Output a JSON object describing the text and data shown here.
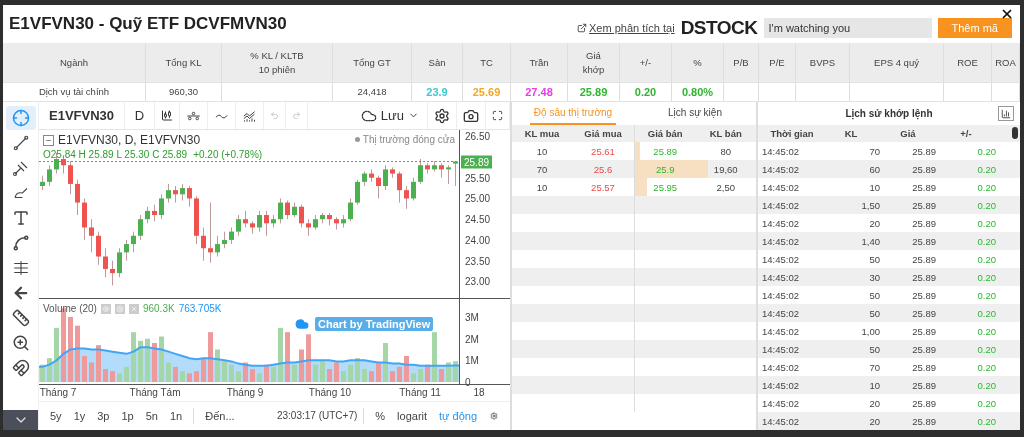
{
  "window": {
    "title": "E1VFVN30 - Quỹ ETF DCVFMVN30"
  },
  "header": {
    "link": "Xem phân tích tại",
    "logo": "DSTOCK",
    "search": {
      "value": "I'm watching you"
    },
    "add_button": "Thêm mã"
  },
  "stats": {
    "columns": [
      {
        "label": "Ngành",
        "value": "Dịch vụ tài chính"
      },
      {
        "label": "Tổng KL",
        "value": "960,30"
      },
      {
        "label": "% KL / KLTB\n10 phiên"
      },
      {
        "label": "Tổng GT",
        "value": "24,418"
      },
      {
        "label": "Sàn",
        "value": "23.9",
        "color": "#3cc8d0"
      },
      {
        "label": "TC",
        "value": "25.69",
        "color": "#f5a623"
      },
      {
        "label": "Trần",
        "value": "27.48",
        "color": "#e83ee8"
      },
      {
        "label": "Giá\nkhớp",
        "value": "25.89",
        "color": "#2fb52f"
      },
      {
        "label": "+/-",
        "value": "0.20",
        "color": "#2fb52f"
      },
      {
        "label": "%",
        "value": "0.80%",
        "color": "#2fb52f"
      },
      {
        "label": "P/B"
      },
      {
        "label": "P/E"
      },
      {
        "label": "BVPS"
      },
      {
        "label": "EPS 4 quý"
      },
      {
        "label": "ROE"
      },
      {
        "label": "ROA"
      }
    ]
  },
  "chart": {
    "symbol": "E1VFVN30",
    "interval": "D",
    "save": "Lưu",
    "tools": [
      {
        "selected": true
      },
      {
        "selected": false
      },
      {
        "selected": false
      },
      {
        "selected": false
      },
      {
        "selected": false
      },
      {
        "selected": false
      },
      {
        "selected": false
      },
      {
        "selected": false
      },
      {
        "selected": false
      },
      {
        "selected": false
      },
      {
        "selected": false
      }
    ],
    "legend": "E1VFVN30, D, E1VFVN30",
    "status": "Thị trường đóng cửa",
    "ohlc": "O25.84 H 25.89 L 25.30 C 25.89",
    "change": "+0.20 (+0.78%)",
    "price_panel": {
      "chart_data": {
        "type": "candlestick",
        "ylim": [
          22.6,
          26.65
        ],
        "ref_lines": [
          {
            "axis": "y",
            "value": 25.89,
            "label": "25.89",
            "color": "#4caf50"
          }
        ],
        "ohlc": [
          [
            25.3,
            25.55,
            25.2,
            25.4
          ],
          [
            25.4,
            25.8,
            25.3,
            25.7
          ],
          [
            25.7,
            26.1,
            25.6,
            25.95
          ],
          [
            25.95,
            26.05,
            25.6,
            25.8
          ],
          [
            25.8,
            25.9,
            25.1,
            25.35
          ],
          [
            25.35,
            25.45,
            24.6,
            24.9
          ],
          [
            24.9,
            25.0,
            24.0,
            24.3
          ],
          [
            24.3,
            24.5,
            23.7,
            24.1
          ],
          [
            24.1,
            24.2,
            23.4,
            23.6
          ],
          [
            23.6,
            23.8,
            23.1,
            23.3
          ],
          [
            23.3,
            23.5,
            22.9,
            23.2
          ],
          [
            23.2,
            23.8,
            23.1,
            23.7
          ],
          [
            23.7,
            24.0,
            23.5,
            23.9
          ],
          [
            23.9,
            24.2,
            23.7,
            24.1
          ],
          [
            24.1,
            24.6,
            24.0,
            24.5
          ],
          [
            24.5,
            24.8,
            24.4,
            24.7
          ],
          [
            24.7,
            24.85,
            24.45,
            24.6
          ],
          [
            24.6,
            25.1,
            24.5,
            25.0
          ],
          [
            25.0,
            25.35,
            24.9,
            25.2
          ],
          [
            25.2,
            25.3,
            24.9,
            25.1
          ],
          [
            25.1,
            25.35,
            24.95,
            25.25
          ],
          [
            25.25,
            25.3,
            24.8,
            25.0
          ],
          [
            25.0,
            25.05,
            23.9,
            24.1
          ],
          [
            24.1,
            24.3,
            23.5,
            23.8
          ],
          [
            23.8,
            24.9,
            23.45,
            23.7
          ],
          [
            23.7,
            24.1,
            23.6,
            23.9
          ],
          [
            23.9,
            24.2,
            23.8,
            24.0
          ],
          [
            24.0,
            24.3,
            23.9,
            24.2
          ],
          [
            24.2,
            24.6,
            24.1,
            24.5
          ],
          [
            24.5,
            24.7,
            24.3,
            24.4
          ],
          [
            24.4,
            24.45,
            24.15,
            24.3
          ],
          [
            24.3,
            24.7,
            24.2,
            24.6
          ],
          [
            24.6,
            24.7,
            24.1,
            24.4
          ],
          [
            24.4,
            24.6,
            24.3,
            24.5
          ],
          [
            24.5,
            25.0,
            24.4,
            24.9
          ],
          [
            24.9,
            24.95,
            24.5,
            24.6
          ],
          [
            24.6,
            24.9,
            24.55,
            24.8
          ],
          [
            24.8,
            24.85,
            24.3,
            24.4
          ],
          [
            24.4,
            24.5,
            24.1,
            24.3
          ],
          [
            24.3,
            24.6,
            24.25,
            24.5
          ],
          [
            24.5,
            24.65,
            24.4,
            24.6
          ],
          [
            24.6,
            24.65,
            24.35,
            24.5
          ],
          [
            24.5,
            24.55,
            24.25,
            24.4
          ],
          [
            24.4,
            24.6,
            24.3,
            24.5
          ],
          [
            24.5,
            25.0,
            24.45,
            24.9
          ],
          [
            24.9,
            25.45,
            24.85,
            25.4
          ],
          [
            25.4,
            25.65,
            25.3,
            25.6
          ],
          [
            25.6,
            25.7,
            25.4,
            25.5
          ],
          [
            25.5,
            25.55,
            25.0,
            25.3
          ],
          [
            25.3,
            25.8,
            25.2,
            25.7
          ],
          [
            25.7,
            25.75,
            25.5,
            25.6
          ],
          [
            25.6,
            25.65,
            24.9,
            25.2
          ],
          [
            25.2,
            25.3,
            24.75,
            25.0
          ],
          [
            25.0,
            25.5,
            24.95,
            25.4
          ],
          [
            25.4,
            25.95,
            25.35,
            25.8
          ],
          [
            25.8,
            25.85,
            25.6,
            25.7
          ],
          [
            25.7,
            25.9,
            25.65,
            25.8
          ],
          [
            25.8,
            25.85,
            25.5,
            25.7
          ],
          [
            25.7,
            25.8,
            25.35,
            25.75
          ],
          [
            25.84,
            25.89,
            25.3,
            25.89
          ]
        ],
        "yticks": [
          {
            "value": 26.5,
            "label": "26.50"
          },
          {
            "value": 25.5,
            "label": "25.50"
          },
          {
            "value": 25,
            "label": "25.00"
          },
          {
            "value": 24.5,
            "label": "24.50"
          },
          {
            "value": 24,
            "label": "24.00"
          },
          {
            "value": 23.5,
            "label": "23.50"
          },
          {
            "value": 23,
            "label": "23.00"
          }
        ]
      }
    },
    "time_axis": [
      "Tháng 7",
      "Tháng Tám",
      "Tháng 9",
      "Tháng 10",
      "Tháng 11",
      "18"
    ],
    "volume_value": "960.3K",
    "volume_ma": "763.705K",
    "volume_panel": {
      "chart_data": {
        "type": "bar",
        "ylim": [
          0,
          3.6
        ],
        "series": [
          {
            "name": "Volume (20)",
            "colors": [
              "#a5d6a7",
              "#a5d6a7",
              "#a5d6a7",
              "#ef9a9a",
              "#ef9a9a",
              "#ef9a9a",
              "#ef9a9a",
              "#ef9a9a",
              "#ef9a9a",
              "#ef9a9a",
              "#ef9a9a",
              "#a5d6a7",
              "#a5d6a7",
              "#a5d6a7",
              "#a5d6a7",
              "#a5d6a7",
              "#ef9a9a",
              "#a5d6a7",
              "#a5d6a7",
              "#ef9a9a",
              "#a5d6a7",
              "#ef9a9a",
              "#ef9a9a",
              "#ef9a9a",
              "#ef9a9a",
              "#a5d6a7",
              "#a5d6a7",
              "#a5d6a7",
              "#a5d6a7",
              "#ef9a9a",
              "#ef9a9a",
              "#a5d6a7",
              "#ef9a9a",
              "#a5d6a7",
              "#a5d6a7",
              "#ef9a9a",
              "#a5d6a7",
              "#ef9a9a",
              "#ef9a9a",
              "#a5d6a7",
              "#a5d6a7",
              "#ef9a9a",
              "#ef9a9a",
              "#a5d6a7",
              "#a5d6a7",
              "#a5d6a7",
              "#a5d6a7",
              "#ef9a9a",
              "#ef9a9a",
              "#a5d6a7",
              "#ef9a9a",
              "#ef9a9a",
              "#ef9a9a",
              "#a5d6a7",
              "#a5d6a7",
              "#ef9a9a",
              "#a5d6a7",
              "#ef9a9a",
              "#a5d6a7",
              "#a5d6a7"
            ],
            "values": [
              0.8,
              1.1,
              2.5,
              3.4,
              3.0,
              2.6,
              1.2,
              0.9,
              1.7,
              0.6,
              0.5,
              0.4,
              0.7,
              2.3,
              1.9,
              2.0,
              1.8,
              2.1,
              0.9,
              0.7,
              0.5,
              0.4,
              0.5,
              1.1,
              2.3,
              1.5,
              1.0,
              0.8,
              0.5,
              0.9,
              0.6,
              0.4,
              0.8,
              0.7,
              2.5,
              2.3,
              0.8,
              1.5,
              2.2,
              0.8,
              1.0,
              0.6,
              0.9,
              0.5,
              0.8,
              1.1,
              0.6,
              0.5,
              0.9,
              1.8,
              0.5,
              0.7,
              1.2,
              0.4,
              0.6,
              0.8,
              2.3,
              0.6,
              0.9,
              0.96
            ]
          },
          {
            "type": "area",
            "color": "#42a5f5",
            "values": [
              0.7,
              0.8,
              1.0,
              1.3,
              1.5,
              1.55,
              1.55,
              1.5,
              1.5,
              1.45,
              1.4,
              1.35,
              1.3,
              1.4,
              1.6,
              1.6,
              1.55,
              1.5,
              1.4,
              1.3,
              1.2,
              1.1,
              1.05,
              1.1,
              1.1,
              1.05,
              1.0,
              0.95,
              0.85,
              0.8,
              0.75,
              0.75,
              0.75,
              0.8,
              0.85,
              0.9,
              0.9,
              0.95,
              1.0,
              1.0,
              1.0,
              1.0,
              0.95,
              0.95,
              1.0,
              1.0,
              1.0,
              0.95,
              0.9,
              0.9,
              0.85,
              0.85,
              0.8,
              0.8,
              0.75,
              0.75,
              0.75,
              0.75,
              0.75,
              0.76
            ]
          }
        ],
        "yticks": [
          {
            "value": 3,
            "label": "3M"
          },
          {
            "value": 2,
            "label": "2M"
          },
          {
            "value": 1,
            "label": "1M"
          },
          {
            "value": 0,
            "label": "0"
          }
        ]
      }
    },
    "attribution": "Chart by TradingView",
    "ranges": [
      "5y",
      "1y",
      "3p",
      "1p",
      "5n",
      "1n"
    ],
    "goto": "Đến...",
    "clock": "23:03:17 (UTC+7)",
    "scale_options": [
      {
        "label": "%",
        "selected": false
      },
      {
        "label": "logarit",
        "selected": false
      },
      {
        "label": "tự động",
        "selected": true
      }
    ]
  },
  "order_book": {
    "tabs": [
      {
        "label": "Độ sâu thị trường",
        "selected": true
      },
      {
        "label": "Lịch sự kiện",
        "selected": false
      }
    ],
    "columns": [
      "KL mua",
      "Giá mua",
      "Giá bán",
      "KL bán"
    ],
    "rows": [
      {
        "bid_volume": "10",
        "bid_price": "25.61",
        "ask_price": "25.89",
        "ask_volume": "80",
        "level": 0.04
      },
      {
        "bid_volume": "70",
        "bid_price": "25.6",
        "ask_price": "25.9",
        "ask_volume": "19,60",
        "level": 0.6
      },
      {
        "bid_volume": "10",
        "bid_price": "25.57",
        "ask_price": "25.95",
        "ask_volume": "2,50",
        "level": 0.1
      }
    ]
  },
  "trades": {
    "title": "Lịch sử khớp lệnh",
    "columns": [
      "Thời gian",
      "KL",
      "Giá",
      "+/-"
    ],
    "rows": [
      {
        "time": "14:45:02",
        "volume": "70",
        "price": "25.89",
        "change": "0.20"
      },
      {
        "time": "14:45:02",
        "volume": "60",
        "price": "25.89",
        "change": "0.20"
      },
      {
        "time": "14:45:02",
        "volume": "10",
        "price": "25.89",
        "change": "0.20"
      },
      {
        "time": "14:45:02",
        "volume": "1,50",
        "price": "25.89",
        "change": "0.20"
      },
      {
        "time": "14:45:02",
        "volume": "20",
        "price": "25.89",
        "change": "0.20"
      },
      {
        "time": "14:45:02",
        "volume": "1,40",
        "price": "25.89",
        "change": "0.20"
      },
      {
        "time": "14:45:02",
        "volume": "50",
        "price": "25.89",
        "change": "0.20"
      },
      {
        "time": "14:45:02",
        "volume": "30",
        "price": "25.89",
        "change": "0.20"
      },
      {
        "time": "14:45:02",
        "volume": "50",
        "price": "25.89",
        "change": "0.20"
      },
      {
        "time": "14:45:02",
        "volume": "50",
        "price": "25.89",
        "change": "0.20"
      },
      {
        "time": "14:45:02",
        "volume": "1,00",
        "price": "25.89",
        "change": "0.20"
      },
      {
        "time": "14:45:02",
        "volume": "50",
        "price": "25.89",
        "change": "0.20"
      },
      {
        "time": "14:45:02",
        "volume": "70",
        "price": "25.89",
        "change": "0.20"
      },
      {
        "time": "14:45:02",
        "volume": "10",
        "price": "25.89",
        "change": "0.20"
      },
      {
        "time": "14:45:02",
        "volume": "20",
        "price": "25.89",
        "change": "0.20"
      },
      {
        "time": "14:45:02",
        "volume": "20",
        "price": "25.89",
        "change": "0.20"
      }
    ]
  }
}
